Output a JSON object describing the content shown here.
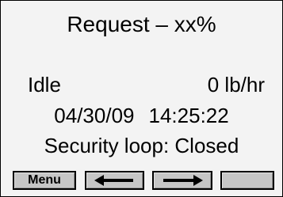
{
  "display": {
    "title": "Request – xx%",
    "status": "Idle",
    "flow_rate": "0 lb/hr",
    "date": "04/30/09",
    "time": "14:25:22",
    "security_loop": "Security loop: Closed"
  },
  "softkeys": {
    "menu_label": "Menu",
    "left_icon": "arrow-left-icon",
    "right_icon": "arrow-right-icon",
    "fourth_label": ""
  },
  "colors": {
    "screen_background": "#f3f3f3",
    "softkey_face": "#c6c6c6",
    "text": "#000000"
  }
}
